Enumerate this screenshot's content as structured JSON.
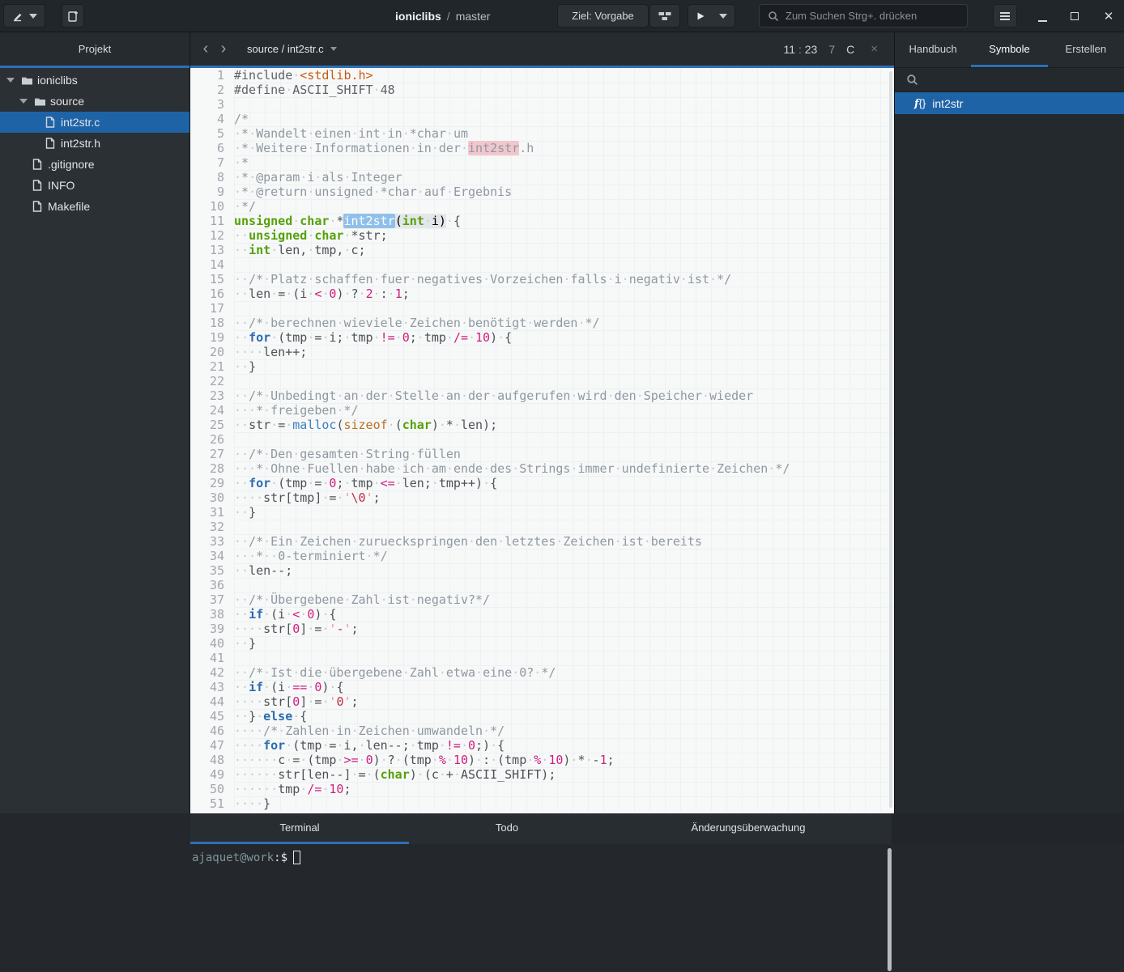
{
  "colors": {
    "accent_blue": "#2d6fb5",
    "selection_blue": "#1f63a7",
    "search_match_pink": "#f2c6cd",
    "focus_match_blue": "#90c0ea"
  },
  "header": {
    "title_project": "ioniclibs",
    "title_separator": "/",
    "title_branch": "master",
    "target_button_label": "Ziel: Vorgabe",
    "search_placeholder": "Zum Suchen Strg+. drücken"
  },
  "sidebar": {
    "title": "Projekt",
    "tree": [
      {
        "label": "ioniclibs",
        "type": "folder",
        "depth": 0,
        "expanded": true,
        "selected": false
      },
      {
        "label": "source",
        "type": "folder",
        "depth": 1,
        "expanded": true,
        "selected": false
      },
      {
        "label": "int2str.c",
        "type": "file",
        "depth": 2,
        "expanded": false,
        "selected": true
      },
      {
        "label": "int2str.h",
        "type": "file",
        "depth": 2,
        "expanded": false,
        "selected": false
      },
      {
        "label": ".gitignore",
        "type": "file",
        "depth": 1,
        "expanded": false,
        "selected": false
      },
      {
        "label": "INFO",
        "type": "file",
        "depth": 1,
        "expanded": false,
        "selected": false
      },
      {
        "label": "Makefile",
        "type": "file",
        "depth": 1,
        "expanded": false,
        "selected": false
      }
    ]
  },
  "editor": {
    "breadcrumb": "source / int2str.c",
    "cursor_line": "11",
    "cursor_separator": ":",
    "cursor_col": "23",
    "diagnostic_count": "7",
    "language": "C",
    "close_glyph": "×",
    "lines": [
      [
        [
          "pre",
          "#include "
        ],
        [
          "inc",
          "<stdlib.h>"
        ]
      ],
      [
        [
          "pre",
          "#define ASCII_SHIFT 48"
        ]
      ],
      [],
      [
        [
          "com",
          "/*"
        ]
      ],
      [
        [
          "com",
          " * Wandelt einen int in *char um"
        ]
      ],
      [
        [
          "com",
          " * Weitere Informationen in der "
        ],
        [
          "com match",
          "int2str"
        ],
        [
          "com",
          ".h"
        ]
      ],
      [
        [
          "com",
          " *"
        ]
      ],
      [
        [
          "com",
          " * @param i als Integer"
        ]
      ],
      [
        [
          "com",
          " * @return unsigned *char auf Ergebnis"
        ]
      ],
      [
        [
          "com",
          " */"
        ]
      ],
      [
        [
          "type",
          "unsigned"
        ],
        [
          "plain",
          " "
        ],
        [
          "type",
          "char"
        ],
        [
          "plain",
          " *"
        ],
        [
          "sel",
          "int2str"
        ],
        [
          "phl",
          "("
        ],
        [
          "type phl",
          "int"
        ],
        [
          "phl",
          " i)"
        ],
        [
          "plain",
          " {"
        ]
      ],
      [
        [
          "plain",
          "  "
        ],
        [
          "type",
          "unsigned"
        ],
        [
          "plain",
          " "
        ],
        [
          "type",
          "char"
        ],
        [
          "plain",
          " *str;"
        ]
      ],
      [
        [
          "plain",
          "  "
        ],
        [
          "type",
          "int"
        ],
        [
          "plain",
          " len, tmp, c;"
        ]
      ],
      [],
      [
        [
          "plain",
          "  "
        ],
        [
          "com",
          "/* Platz schaffen fuer negatives Vorzeichen falls i negativ ist */"
        ]
      ],
      [
        [
          "plain",
          "  len = (i "
        ],
        [
          "op",
          "<"
        ],
        [
          "plain",
          " "
        ],
        [
          "num",
          "0"
        ],
        [
          "plain",
          ") ? "
        ],
        [
          "num",
          "2"
        ],
        [
          "plain",
          " : "
        ],
        [
          "num",
          "1"
        ],
        [
          "plain",
          ";"
        ]
      ],
      [],
      [
        [
          "plain",
          "  "
        ],
        [
          "com",
          "/* berechnen wieviele Zeichen benötigt werden */"
        ]
      ],
      [
        [
          "plain",
          "  "
        ],
        [
          "kw",
          "for"
        ],
        [
          "plain",
          " (tmp = i; tmp "
        ],
        [
          "op",
          "!="
        ],
        [
          "plain",
          " "
        ],
        [
          "num",
          "0"
        ],
        [
          "plain",
          "; tmp "
        ],
        [
          "op",
          "/="
        ],
        [
          "plain",
          " "
        ],
        [
          "num",
          "10"
        ],
        [
          "plain",
          ") {"
        ]
      ],
      [
        [
          "plain",
          "    len++;"
        ]
      ],
      [
        [
          "plain",
          "  }"
        ]
      ],
      [],
      [
        [
          "plain",
          "  "
        ],
        [
          "com",
          "/* Unbedingt an der Stelle an der aufgerufen wird den Speicher wieder"
        ]
      ],
      [
        [
          "com",
          "   * freigeben */"
        ]
      ],
      [
        [
          "plain",
          "  str = "
        ],
        [
          "fn",
          "malloc"
        ],
        [
          "plain",
          "("
        ],
        [
          "szof",
          "sizeof"
        ],
        [
          "plain",
          " ("
        ],
        [
          "type",
          "char"
        ],
        [
          "plain",
          ") * len);"
        ]
      ],
      [],
      [
        [
          "plain",
          "  "
        ],
        [
          "com",
          "/* Den gesamten String füllen"
        ]
      ],
      [
        [
          "com",
          "   * Ohne Fuellen habe ich am ende des Strings immer undefinierte Zeichen */"
        ]
      ],
      [
        [
          "plain",
          "  "
        ],
        [
          "kw",
          "for"
        ],
        [
          "plain",
          " (tmp = "
        ],
        [
          "num",
          "0"
        ],
        [
          "plain",
          "; tmp "
        ],
        [
          "op",
          "<="
        ],
        [
          "plain",
          " len; tmp++) {"
        ]
      ],
      [
        [
          "plain",
          "    str[tmp] = "
        ],
        [
          "strq",
          "'"
        ],
        [
          "strc",
          "\\0"
        ],
        [
          "strq",
          "'"
        ],
        [
          "plain",
          ";"
        ]
      ],
      [
        [
          "plain",
          "  }"
        ]
      ],
      [],
      [
        [
          "plain",
          "  "
        ],
        [
          "com",
          "/* Ein Zeichen zurueckspringen den letztes Zeichen ist bereits"
        ]
      ],
      [
        [
          "com",
          "   *  0-terminiert */"
        ]
      ],
      [
        [
          "plain",
          "  len--;"
        ]
      ],
      [],
      [
        [
          "plain",
          "  "
        ],
        [
          "com",
          "/* Übergebene Zahl ist negativ?*/"
        ]
      ],
      [
        [
          "plain",
          "  "
        ],
        [
          "kw",
          "if"
        ],
        [
          "plain",
          " (i "
        ],
        [
          "op",
          "<"
        ],
        [
          "plain",
          " "
        ],
        [
          "num",
          "0"
        ],
        [
          "plain",
          ") {"
        ]
      ],
      [
        [
          "plain",
          "    str["
        ],
        [
          "num",
          "0"
        ],
        [
          "plain",
          "] = "
        ],
        [
          "strq",
          "'"
        ],
        [
          "strc",
          "-"
        ],
        [
          "strq",
          "'"
        ],
        [
          "plain",
          ";"
        ]
      ],
      [
        [
          "plain",
          "  }"
        ]
      ],
      [],
      [
        [
          "plain",
          "  "
        ],
        [
          "com",
          "/* Ist die übergebene Zahl etwa eine 0? */"
        ]
      ],
      [
        [
          "plain",
          "  "
        ],
        [
          "kw",
          "if"
        ],
        [
          "plain",
          " (i "
        ],
        [
          "op",
          "=="
        ],
        [
          "plain",
          " "
        ],
        [
          "num",
          "0"
        ],
        [
          "plain",
          ") {"
        ]
      ],
      [
        [
          "plain",
          "    str["
        ],
        [
          "num",
          "0"
        ],
        [
          "plain",
          "] = "
        ],
        [
          "strq",
          "'"
        ],
        [
          "strc",
          "0"
        ],
        [
          "strq",
          "'"
        ],
        [
          "plain",
          ";"
        ]
      ],
      [
        [
          "plain",
          "  } "
        ],
        [
          "kw",
          "else"
        ],
        [
          "plain",
          " {"
        ]
      ],
      [
        [
          "plain",
          "    "
        ],
        [
          "com",
          "/* Zahlen in Zeichen umwandeln */"
        ]
      ],
      [
        [
          "plain",
          "    "
        ],
        [
          "kw",
          "for"
        ],
        [
          "plain",
          " (tmp = i, len--; tmp "
        ],
        [
          "op",
          "!="
        ],
        [
          "plain",
          " "
        ],
        [
          "num",
          "0"
        ],
        [
          "plain",
          ";) {"
        ]
      ],
      [
        [
          "plain",
          "      c = (tmp "
        ],
        [
          "op",
          ">="
        ],
        [
          "plain",
          " "
        ],
        [
          "num",
          "0"
        ],
        [
          "plain",
          ") ? (tmp "
        ],
        [
          "op",
          "%"
        ],
        [
          "plain",
          " "
        ],
        [
          "num",
          "10"
        ],
        [
          "plain",
          ") : (tmp "
        ],
        [
          "op",
          "%"
        ],
        [
          "plain",
          " "
        ],
        [
          "num",
          "10"
        ],
        [
          "plain",
          ") * -"
        ],
        [
          "num",
          "1"
        ],
        [
          "plain",
          ";"
        ]
      ],
      [
        [
          "plain",
          "      str[len--] = ("
        ],
        [
          "type",
          "char"
        ],
        [
          "plain",
          ") (c + ASCII_SHIFT);"
        ]
      ],
      [
        [
          "plain",
          "      tmp "
        ],
        [
          "op",
          "/="
        ],
        [
          "plain",
          " "
        ],
        [
          "num",
          "10"
        ],
        [
          "plain",
          ";"
        ]
      ],
      [
        [
          "plain",
          "    }"
        ]
      ]
    ]
  },
  "symbols": {
    "tabs": [
      {
        "label": "Handbuch",
        "active": false
      },
      {
        "label": "Symbole",
        "active": true
      },
      {
        "label": "Erstellen",
        "active": false
      }
    ],
    "items": [
      {
        "label": "int2str",
        "icon": "function",
        "selected": true
      }
    ]
  },
  "bottom": {
    "tabs": [
      {
        "label": "Terminal",
        "active": true
      },
      {
        "label": "Todo",
        "active": false
      },
      {
        "label": "Änderungsüberwachung",
        "active": false
      }
    ],
    "terminal": {
      "user_host": "ajaquet@work",
      "prompt_suffix": ":$"
    }
  }
}
